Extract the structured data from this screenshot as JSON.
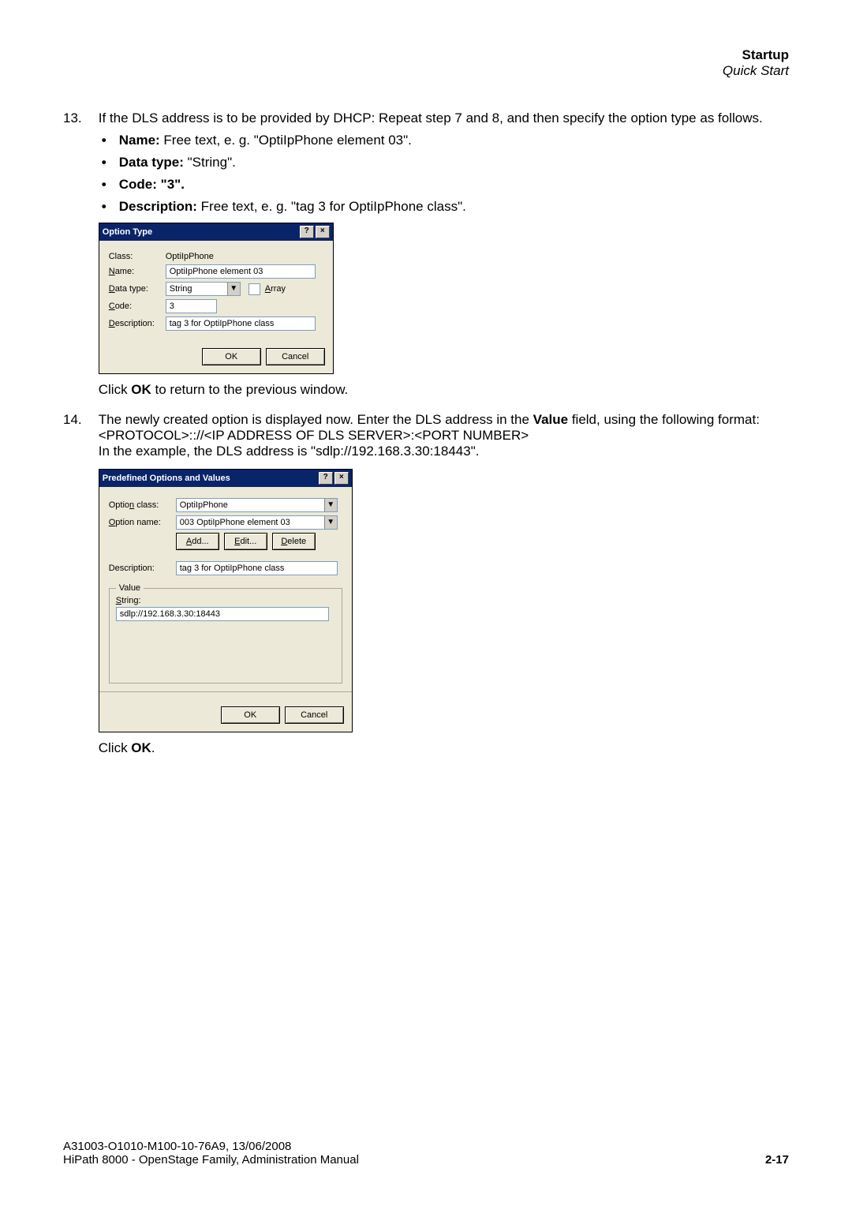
{
  "header": {
    "title": "Startup",
    "subtitle": "Quick Start"
  },
  "steps": {
    "s13": {
      "num": "13.",
      "intro": "If the DLS address is to be provided by DHCP: Repeat step 7 and 8, and then specify the option type as follows.",
      "bullets": {
        "name_lbl": "Name:",
        "name_txt": " Free text, e. g. \"OptiIpPhone element 03\".",
        "dtype_lbl": "Data type:",
        "dtype_txt": " \"String\".",
        "code_lbl": "Code:",
        "code_txt": " \"3\".",
        "desc_lbl": "Description:",
        "desc_txt": " Free text, e. g. \"tag 3 for OptiIpPhone class\"."
      },
      "after_dlg_1": "Click ",
      "after_dlg_ok": "OK",
      "after_dlg_2": " to return to the previous window."
    },
    "s14": {
      "num": "14.",
      "l1a": "The newly created option is displayed now. Enter the DLS address in the ",
      "l1b": "Value",
      "l1c": " field, using the following format:",
      "l2": "<PROTOCOL>:://<IP ADDRESS OF DLS SERVER>:<PORT NUMBER>",
      "l3": "In the example, the DLS address is \"sdlp://192.168.3.30:18443\".",
      "after_1": "Click ",
      "after_ok": "OK",
      "after_2": "."
    }
  },
  "dlg1": {
    "title": "Option Type",
    "class_lbl": "Class:",
    "class_val": "OptiIpPhone",
    "name_lbl_pre": "N",
    "name_lbl_post": "ame:",
    "name_val": "OptiIpPhone element 03",
    "dtype_lbl_pre": "D",
    "dtype_lbl_post": "ata type:",
    "dtype_val": "String",
    "array_lbl_pre": "A",
    "array_lbl_post": "rray",
    "code_lbl_pre": "C",
    "code_lbl_post": "ode:",
    "code_val": "3",
    "desc_lbl_pre": "D",
    "desc_lbl_post": "escription:",
    "desc_val": "tag 3 for OptiIpPhone class",
    "ok": "OK",
    "cancel": "Cancel"
  },
  "dlg2": {
    "title": "Predefined Options and Values",
    "oclass_lbl": "Optio",
    "oclass_lbl_u": "n",
    "oclass_lbl_post": " class:",
    "oclass_val": "OptiIpPhone",
    "oname_lbl_pre": "O",
    "oname_lbl_post": "ption name:",
    "oname_val": "003 OptiIpPhone element 03",
    "add_u": "A",
    "add": "dd...",
    "edit_u": "E",
    "edit": "dit...",
    "del_u": "D",
    "del": "elete",
    "desc_lbl": "Description:",
    "desc_val": "tag 3 for OptiIpPhone class",
    "value_legend": "Value",
    "string_lbl_pre": "S",
    "string_lbl_post": "tring:",
    "string_val": "sdlp://192.168.3.30:18443",
    "ok": "OK",
    "cancel": "Cancel"
  },
  "footer": {
    "l1": "A31003-O1010-M100-10-76A9, 13/06/2008",
    "l2": "HiPath 8000 - OpenStage Family, Administration Manual",
    "page": "2-17"
  }
}
